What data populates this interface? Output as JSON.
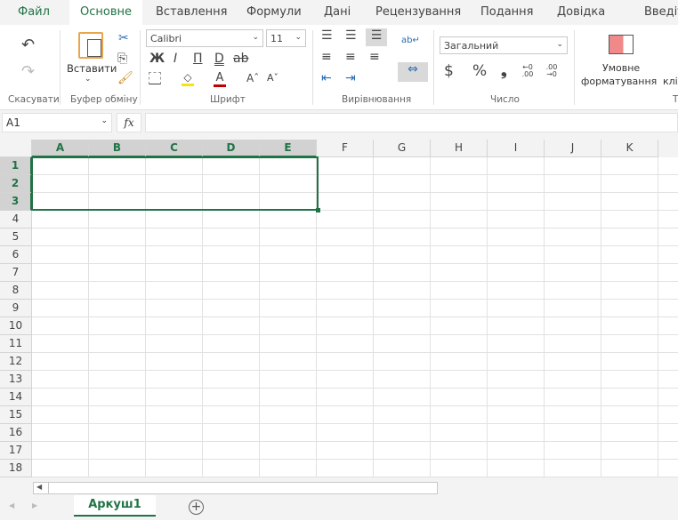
{
  "menu": {
    "tabs": [
      "Файл",
      "Основне",
      "Вставлення",
      "Формули",
      "Дані",
      "Рецензування",
      "Подання",
      "Довідка",
      "Введіть"
    ],
    "active": "Основне"
  },
  "ribbon": {
    "undo": {
      "label": "Скасувати"
    },
    "clipboard": {
      "paste": "Вставити",
      "label": "Буфер обміну"
    },
    "font": {
      "name": "Calibri",
      "size": "11",
      "bold": "Ж",
      "italic": "І",
      "underline": "П",
      "double_underline": "D",
      "strike": "ab",
      "grow": "Aˆ",
      "shrink": "Aˇ",
      "label": "Шрифт"
    },
    "alignment": {
      "label": "Вирівнювання"
    },
    "number": {
      "format": "Загальний",
      "currency": "$",
      "percent": "%",
      "comma": "❟",
      "inc_decimal": "←0 .00",
      "dec_decimal": ".00 →0",
      "label": "Число"
    },
    "styles": {
      "conditional_line1": "Умовне",
      "conditional_line2": "форматування",
      "next": "клі",
      "label": "Т"
    }
  },
  "formula_bar": {
    "name_box": "A1",
    "fx": "fx",
    "value": ""
  },
  "grid": {
    "columns": [
      "A",
      "B",
      "C",
      "D",
      "E",
      "F",
      "G",
      "H",
      "I",
      "J",
      "K"
    ],
    "rows": [
      "1",
      "2",
      "3",
      "4",
      "5",
      "6",
      "7",
      "8",
      "9",
      "10",
      "11",
      "12",
      "13",
      "14",
      "15",
      "16",
      "17",
      "18"
    ],
    "selection": "A1:E3"
  },
  "sheets": {
    "tabs": [
      "Аркуш1"
    ],
    "add": "+"
  },
  "colors": {
    "accent": "#217346"
  }
}
